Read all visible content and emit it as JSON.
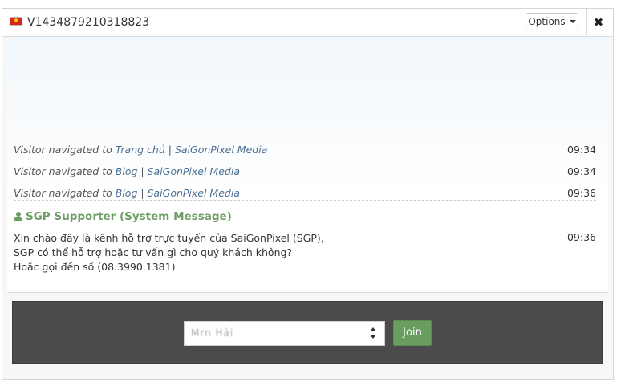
{
  "window": {
    "title": "V1434879210318823",
    "options_label": "Options",
    "close_symbol": "✖"
  },
  "navigation_events": [
    {
      "prefix": "Visitor navigated to ",
      "page": "Trang chủ",
      "sep": " | ",
      "site": "SaiGonPixel Media",
      "time": "09:34"
    },
    {
      "prefix": "Visitor navigated to ",
      "page": "Blog",
      "sep": " | ",
      "site": "SaiGonPixel Media",
      "time": "09:34"
    },
    {
      "prefix": "Visitor navigated to ",
      "page": "Blog",
      "sep": " | ",
      "site": "SaiGonPixel Media",
      "time": "09:36"
    }
  ],
  "system_message": {
    "sender": "SGP Supporter (System Message)",
    "lines": [
      "Xin chào đây là kênh hỗ trợ trực tuyến của SaiGonPixel (SGP),",
      "SGP có thể hỗ trợ hoặc tư vấn gì cho quý khách không?",
      "Hoặc gọi đến số (08.3990.1381)"
    ],
    "time": "09:36"
  },
  "join": {
    "select_value": "Mrn Hải",
    "button_label": "Join"
  },
  "colors": {
    "link": "#4a6f94",
    "sender": "#6c9d63",
    "join_panel": "#4b4b4b",
    "join_button": "#6a9d60"
  },
  "icons": {
    "flag": "vietnam-flag-icon",
    "user": "user-icon",
    "close": "close-icon",
    "caret": "caret-down-icon"
  }
}
